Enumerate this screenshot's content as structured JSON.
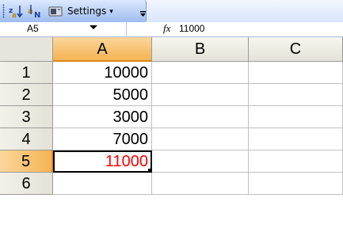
{
  "toolbar": {
    "settings_label": "Settings",
    "icons": [
      "sort-ascending-icon",
      "sort-numeric-icon",
      "camera-icon",
      "toolbar-options-icon"
    ]
  },
  "formula_bar": {
    "name_box": "A5",
    "fx_label": "fx",
    "value": "11000"
  },
  "sheet": {
    "columns": [
      "A",
      "B",
      "C"
    ],
    "rows": [
      {
        "num": "1",
        "a": "10000"
      },
      {
        "num": "2",
        "a": "5000"
      },
      {
        "num": "3",
        "a": "3000"
      },
      {
        "num": "4",
        "a": "7000"
      },
      {
        "num": "5",
        "a": "11000"
      },
      {
        "num": "6",
        "a": ""
      }
    ],
    "active_cell": "A5",
    "active_value_color": "#ff0000",
    "highlight_color": "#f5b354"
  }
}
